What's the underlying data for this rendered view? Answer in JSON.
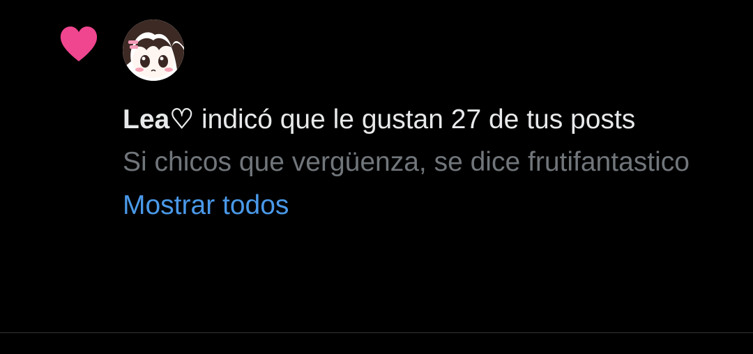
{
  "colors": {
    "background": "#000000",
    "heart": "#f0458f",
    "primary_text": "#e7e9ea",
    "secondary_text": "#71767b",
    "link": "#4a99e9",
    "divider": "#2f3336"
  },
  "notification": {
    "icon": "heart-icon",
    "avatar_icon": "anime-girl-avatar",
    "user_name": "Lea♡",
    "action_text": " indicó que le gustan 27 de tus posts",
    "preview_text": "Si chicos que vergüenza, se dice frutifantastico",
    "show_all_label": "Mostrar todos"
  }
}
